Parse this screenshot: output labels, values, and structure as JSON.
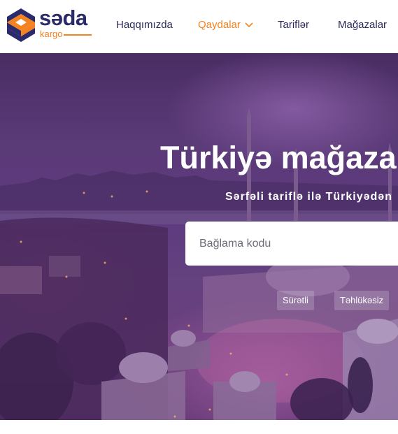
{
  "logo": {
    "word": "səda",
    "sub": "kargo",
    "colors": {
      "navy": "#2b2a6b",
      "orange": "#f58220"
    }
  },
  "nav": {
    "items": [
      {
        "label": "Haqqımızda"
      },
      {
        "label": "Qaydalar",
        "active": true,
        "has_dropdown": true
      },
      {
        "label": "Tariflər"
      },
      {
        "label": "Mağazalar"
      }
    ],
    "dropdown_icon": "chevron-down-icon"
  },
  "hero": {
    "title": "Türkiyə mağazala",
    "subtitle": "Sərfəli tariflə ilə Türkiyədən",
    "search": {
      "placeholder": "Bağlama kodu",
      "value": ""
    },
    "tags": [
      "Sürətli",
      "Təhlükəsiz"
    ]
  },
  "colors": {
    "accent": "#f58220",
    "nav_text": "#2b2a5a",
    "hero_overlay": "#5e3a7f"
  }
}
